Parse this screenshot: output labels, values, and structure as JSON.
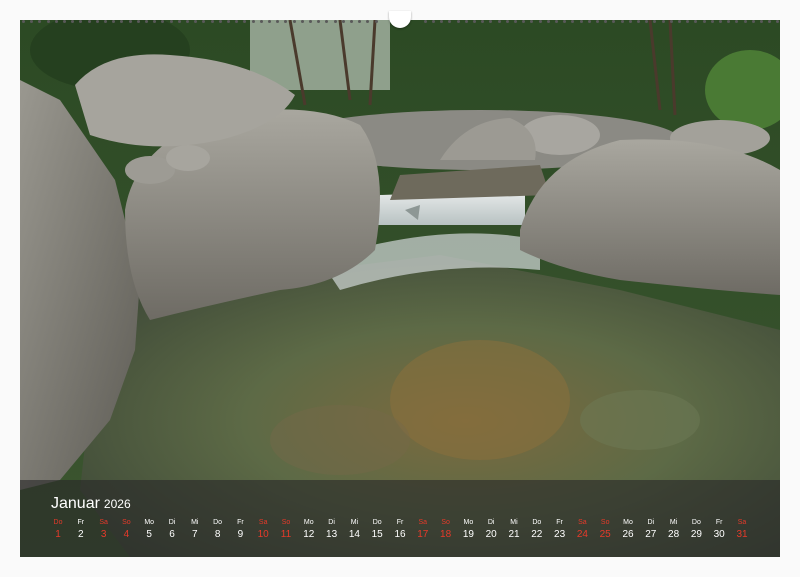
{
  "calendar": {
    "month": "Januar",
    "year": "2026",
    "weekend_color": "#e53a2a",
    "text_color": "#ffffff",
    "days": [
      {
        "wd": "Do",
        "num": "1",
        "weekend": true
      },
      {
        "wd": "Fr",
        "num": "2",
        "weekend": false
      },
      {
        "wd": "Sa",
        "num": "3",
        "weekend": true
      },
      {
        "wd": "So",
        "num": "4",
        "weekend": true
      },
      {
        "wd": "Mo",
        "num": "5",
        "weekend": false
      },
      {
        "wd": "Di",
        "num": "6",
        "weekend": false
      },
      {
        "wd": "Mi",
        "num": "7",
        "weekend": false
      },
      {
        "wd": "Do",
        "num": "8",
        "weekend": false
      },
      {
        "wd": "Fr",
        "num": "9",
        "weekend": false
      },
      {
        "wd": "Sa",
        "num": "10",
        "weekend": true
      },
      {
        "wd": "So",
        "num": "11",
        "weekend": true
      },
      {
        "wd": "Mo",
        "num": "12",
        "weekend": false
      },
      {
        "wd": "Di",
        "num": "13",
        "weekend": false
      },
      {
        "wd": "Mi",
        "num": "14",
        "weekend": false
      },
      {
        "wd": "Do",
        "num": "15",
        "weekend": false
      },
      {
        "wd": "Fr",
        "num": "16",
        "weekend": false
      },
      {
        "wd": "Sa",
        "num": "17",
        "weekend": true
      },
      {
        "wd": "So",
        "num": "18",
        "weekend": true
      },
      {
        "wd": "Mo",
        "num": "19",
        "weekend": false
      },
      {
        "wd": "Di",
        "num": "20",
        "weekend": false
      },
      {
        "wd": "Mi",
        "num": "21",
        "weekend": false
      },
      {
        "wd": "Do",
        "num": "22",
        "weekend": false
      },
      {
        "wd": "Fr",
        "num": "23",
        "weekend": false
      },
      {
        "wd": "Sa",
        "num": "24",
        "weekend": true
      },
      {
        "wd": "So",
        "num": "25",
        "weekend": true
      },
      {
        "wd": "Mo",
        "num": "26",
        "weekend": false
      },
      {
        "wd": "Di",
        "num": "27",
        "weekend": false
      },
      {
        "wd": "Mi",
        "num": "28",
        "weekend": false
      },
      {
        "wd": "Do",
        "num": "29",
        "weekend": false
      },
      {
        "wd": "Fr",
        "num": "30",
        "weekend": false
      },
      {
        "wd": "Sa",
        "num": "31",
        "weekend": true
      }
    ]
  }
}
